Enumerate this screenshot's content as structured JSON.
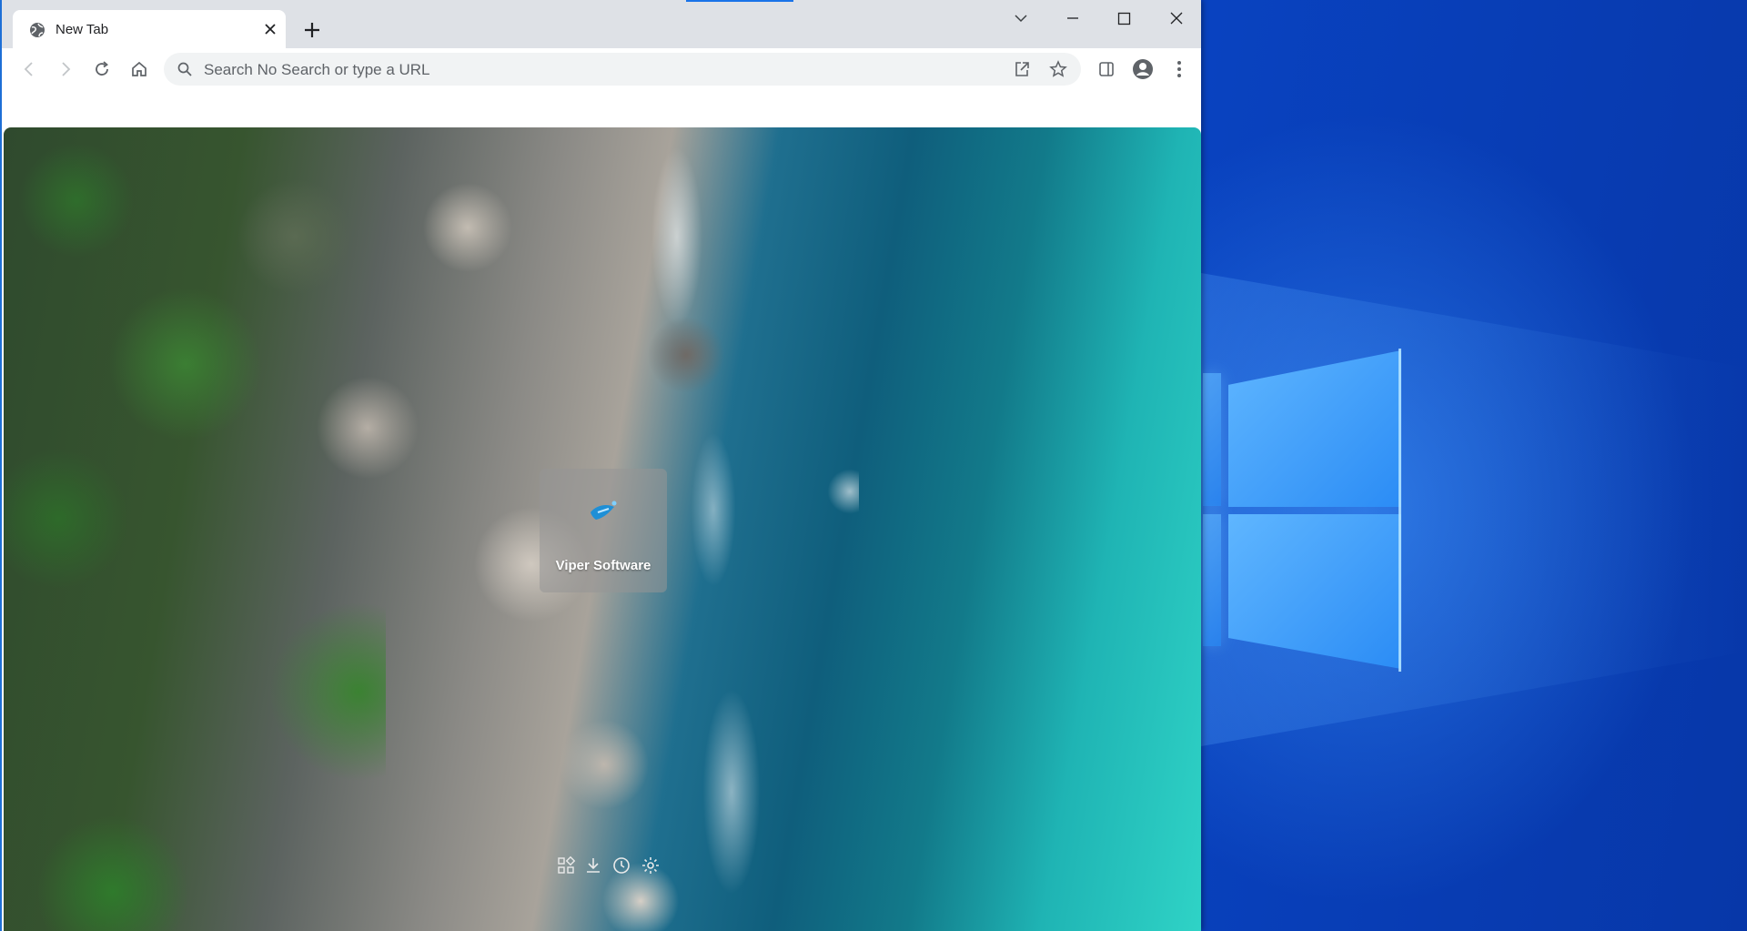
{
  "browser": {
    "tab": {
      "title": "New Tab"
    },
    "omnibox": {
      "placeholder": "Search No Search or type a URL"
    },
    "accent_color": "#1a73e8"
  },
  "ntp": {
    "tile": {
      "label": "Viper Software"
    },
    "bottom_icons": [
      "apps-icon",
      "download-icon",
      "history-icon",
      "settings-icon"
    ]
  },
  "desktop": {
    "background_color": "#0a48cc"
  }
}
